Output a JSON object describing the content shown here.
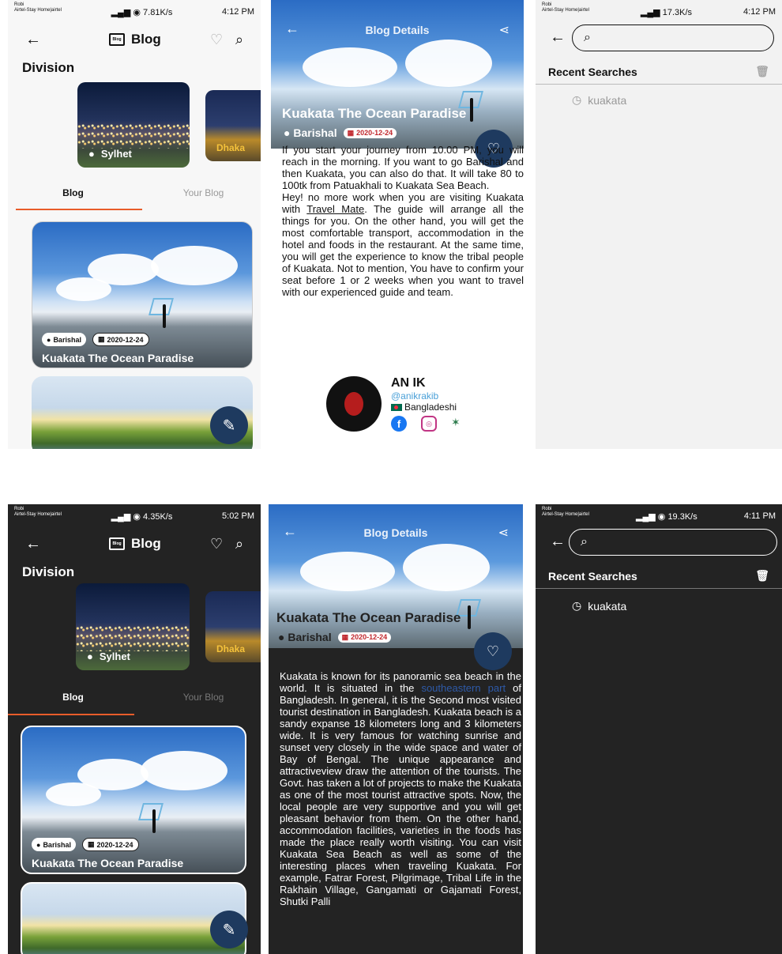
{
  "status": {
    "p1": {
      "carrier": "Robi\nAirtel-Stay Home|airtel",
      "stats": "7.81K/s",
      "time": "4:12 PM"
    },
    "p3": {
      "carrier": "Robi\nAirtel-Stay Home|airtel",
      "stats": "17.3K/s",
      "time": "4:12 PM"
    },
    "p4": {
      "carrier": "Robi\nAirtel-Stay Home|airtel",
      "stats": "4.35K/s",
      "time": "5:02 PM"
    },
    "p6": {
      "carrier": "Robi\nAirtel-Stay Home|airtel",
      "stats": "19.3K/s",
      "time": "4:11 PM"
    }
  },
  "home": {
    "title": "Blog",
    "logo": "Blog",
    "division_title": "Division",
    "divisions": [
      "Sylhet",
      "Dhaka"
    ],
    "tabs": [
      "Blog",
      "Your Blog"
    ],
    "card": {
      "location": "Barishal",
      "date": "2020-12-24",
      "title": "Kuakata The Ocean Paradise"
    }
  },
  "details": {
    "header": "Blog Details",
    "title": "Kuakata The Ocean Paradise",
    "location": "Barishal",
    "date": "2020-12-24",
    "light_text_pre": "If you start your journey from 10.00 PM, you will reach in the morning. If you want to go Barishal and then Kuakata, you can also do that. It will take 80 to 100tk from Patuakhali to Kuakata Sea Beach.\nHey! no more work when you are visiting Kuakata with ",
    "light_link": "Travel Mate",
    "light_text_post": ". The guide will arrange all the things for you. On the other hand, you will get the most comfortable transport, accommodation in the hotel and foods in the restaurant. At the same time, you will get the experience to know the tribal people of Kuakata. Not to mention, You have to confirm your seat before 1 or 2 weeks when you want to travel with our experienced guide and team.",
    "dark_text_pre": "Kuakata is known for its panoramic sea beach in the world. It is situated in the ",
    "dark_link": "southeastern part",
    "dark_text_post": " of Bangladesh. In general, it is the Second most visited tourist destination in Bangladesh. Kuakata beach is a sandy expanse 18 kilometers long and 3 kilometers wide. It is very famous for watching sunrise and sunset very closely in the wide space and water of Bay of Bengal. The unique appearance and attractiveview draw the attention of the tourists. The Govt. has taken a lot of projects to make the Kuakata as one of the most tourist attractive spots. Now, the local people are very supportive and you will get pleasant behavior from them. On the other hand, accommodation facilities, varieties in the foods has made the place really worth visiting. You can visit Kuakata Sea Beach as well as some of the interesting places when traveling Kuakata. For example, Fatrar Forest, Pilgrimage, Tribal Life in the Rakhain Village, Gangamati or Gajamati Forest, Shutki Palli",
    "author": {
      "name": "AN IK",
      "handle": "@anikrakib",
      "nationality": "Bangladeshi"
    }
  },
  "search": {
    "recent_title": "Recent Searches",
    "items": [
      "kuakata"
    ]
  },
  "colors": {
    "accent": "#e85c2a",
    "fab": "#1e3a5f",
    "dark_bg": "#232323",
    "date_red": "#c0262c"
  }
}
